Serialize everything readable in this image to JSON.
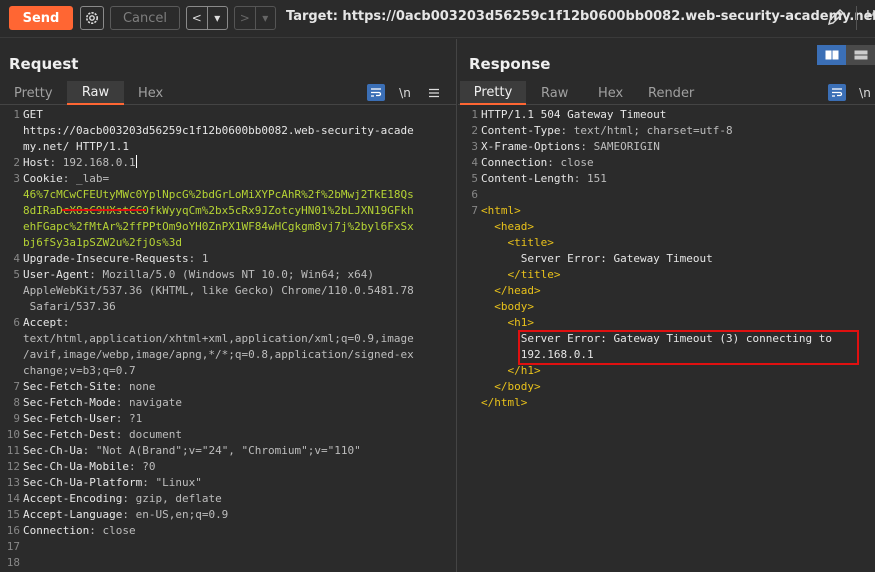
{
  "toolbar": {
    "send_label": "Send",
    "cancel_label": "Cancel",
    "prev_label": "<",
    "prev_menu": "▾",
    "next_label": ">",
    "next_menu": "▾",
    "target_label": "Target: https://0acb003203d56259c1f12b0600bb0082.web-security-academy.net",
    "overflow_text": "H"
  },
  "colors": {
    "accent": "#ff6633",
    "highlight_red": "#e01010",
    "bracket_yellow": "#e8c11b",
    "cookie_green": "#b5d334",
    "toggle_blue": "#3b6fb6"
  },
  "request": {
    "title": "Request",
    "tabs": [
      "Pretty",
      "Raw",
      "Hex"
    ],
    "active_tab": "Raw",
    "icons": [
      "wrap-icon",
      "newline-icon",
      "menu-icon"
    ],
    "newline_glyph": "\\n",
    "lines": [
      {
        "n": "1",
        "key": "GET",
        "sep": "",
        "val": ""
      },
      {
        "n": "",
        "key": "https://0acb003203d56259c1f12b0600bb0082.web-security-acade",
        "sep": "",
        "val": ""
      },
      {
        "n": "",
        "key": "my.net/ HTTP/1.1",
        "sep": "",
        "val": ""
      },
      {
        "n": "2",
        "key": "Host",
        "sep": ": ",
        "val": "192.168.0.1"
      },
      {
        "n": "3",
        "key": "Cookie",
        "sep": ": ",
        "val": "_lab="
      },
      {
        "n": "",
        "key": "",
        "sep": "",
        "val": "46%7cMCwCFEUtyMWc0YplNpcG%2bdGrLoMiXYPcAhR%2f%2bMwj2TkE18Qs"
      },
      {
        "n": "",
        "key": "",
        "sep": "",
        "val": "8dIRaDcX8sC9HXstCCOfkWyyqCm%2bx5cRx9JZotcyHN01%2bLJXN19GFkh"
      },
      {
        "n": "",
        "key": "",
        "sep": "",
        "val": "ehFGapc%2fMtAr%2ffPPtOm9oYH0ZnPX1WF84wHCgkgm8vj7j%2byl6FxSx"
      },
      {
        "n": "",
        "key": "",
        "sep": "",
        "val": "bj6fSy3a1pSZW2u%2fjOs%3d"
      },
      {
        "n": "4",
        "key": "Upgrade-Insecure-Requests",
        "sep": ": ",
        "val": "1"
      },
      {
        "n": "5",
        "key": "User-Agent",
        "sep": ": ",
        "val": "Mozilla/5.0 (Windows NT 10.0; Win64; x64)"
      },
      {
        "n": "",
        "key": "",
        "sep": "",
        "val": "AppleWebKit/537.36 (KHTML, like Gecko) Chrome/110.0.5481.78"
      },
      {
        "n": "",
        "key": "",
        "sep": "",
        "val": " Safari/537.36"
      },
      {
        "n": "6",
        "key": "Accept",
        "sep": ":",
        "val": ""
      },
      {
        "n": "",
        "key": "",
        "sep": "",
        "val": "text/html,application/xhtml+xml,application/xml;q=0.9,image"
      },
      {
        "n": "",
        "key": "",
        "sep": "",
        "val": "/avif,image/webp,image/apng,*/*;q=0.8,application/signed-ex"
      },
      {
        "n": "",
        "key": "",
        "sep": "",
        "val": "change;v=b3;q=0.7"
      },
      {
        "n": "7",
        "key": "Sec-Fetch-Site",
        "sep": ": ",
        "val": "none"
      },
      {
        "n": "8",
        "key": "Sec-Fetch-Mode",
        "sep": ": ",
        "val": "navigate"
      },
      {
        "n": "9",
        "key": "Sec-Fetch-User",
        "sep": ": ",
        "val": "?1"
      },
      {
        "n": "10",
        "key": "Sec-Fetch-Dest",
        "sep": ": ",
        "val": "document"
      },
      {
        "n": "11",
        "key": "Sec-Ch-Ua",
        "sep": ": ",
        "val": "\"Not A(Brand\";v=\"24\", \"Chromium\";v=\"110\""
      },
      {
        "n": "12",
        "key": "Sec-Ch-Ua-Mobile",
        "sep": ": ",
        "val": "?0"
      },
      {
        "n": "13",
        "key": "Sec-Ch-Ua-Platform",
        "sep": ": ",
        "val": "\"Linux\""
      },
      {
        "n": "14",
        "key": "Accept-Encoding",
        "sep": ": ",
        "val": "gzip, deflate"
      },
      {
        "n": "15",
        "key": "Accept-Language",
        "sep": ": ",
        "val": "en-US,en;q=0.9"
      },
      {
        "n": "16",
        "key": "Connection",
        "sep": ": ",
        "val": "close"
      },
      {
        "n": "17",
        "key": "",
        "sep": "",
        "val": ""
      },
      {
        "n": "18",
        "key": "",
        "sep": "",
        "val": ""
      }
    ]
  },
  "response": {
    "title": "Response",
    "tabs": [
      "Pretty",
      "Raw",
      "Hex",
      "Render"
    ],
    "active_tab": "Pretty",
    "icons": [
      "wrap-icon",
      "newline-icon"
    ],
    "newline_glyph": "\\n",
    "lines": [
      {
        "n": "1",
        "key": "HTTP/1.1 504 Gateway Timeout",
        "sep": "",
        "val": ""
      },
      {
        "n": "2",
        "key": "Content-Type",
        "sep": ": ",
        "val": "text/html; charset=utf-8"
      },
      {
        "n": "3",
        "key": "X-Frame-Options",
        "sep": ": ",
        "val": "SAMEORIGIN"
      },
      {
        "n": "4",
        "key": "Connection",
        "sep": ": ",
        "val": "close"
      },
      {
        "n": "5",
        "key": "Content-Length",
        "sep": ": ",
        "val": "151"
      },
      {
        "n": "6",
        "key": "",
        "sep": "",
        "val": ""
      },
      {
        "n": "7",
        "key": "<html>",
        "sep": "",
        "val": ""
      },
      {
        "n": "",
        "key": "  <head>",
        "sep": "",
        "val": ""
      },
      {
        "n": "",
        "key": "    <title>",
        "sep": "",
        "val": ""
      },
      {
        "n": "",
        "key": "      Server Error: Gateway Timeout",
        "sep": "",
        "val": ""
      },
      {
        "n": "",
        "key": "    </title>",
        "sep": "",
        "val": ""
      },
      {
        "n": "",
        "key": "  </head>",
        "sep": "",
        "val": ""
      },
      {
        "n": "",
        "key": "  <body>",
        "sep": "",
        "val": ""
      },
      {
        "n": "",
        "key": "    <h1>",
        "sep": "",
        "val": ""
      },
      {
        "n": "",
        "key": "      Server Error: Gateway Timeout (3) connecting to",
        "sep": "",
        "val": ""
      },
      {
        "n": "",
        "key": "      192.168.0.1",
        "sep": "",
        "val": ""
      },
      {
        "n": "",
        "key": "    </h1>",
        "sep": "",
        "val": ""
      },
      {
        "n": "",
        "key": "  </body>",
        "sep": "",
        "val": ""
      },
      {
        "n": "",
        "key": "</html>",
        "sep": "",
        "val": ""
      }
    ]
  }
}
